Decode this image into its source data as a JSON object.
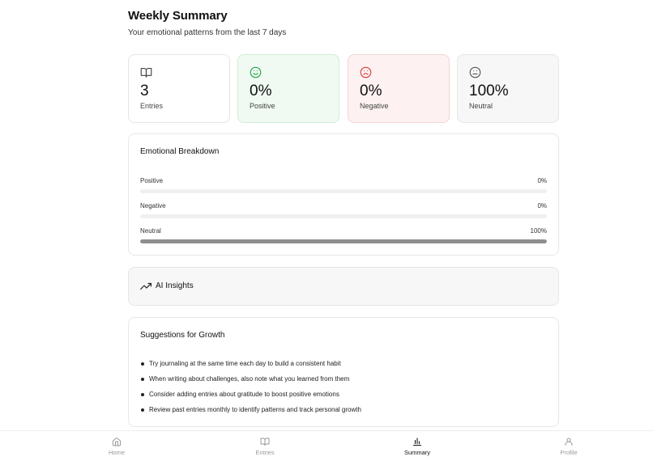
{
  "header": {
    "title": "Weekly Summary",
    "subtitle": "Your emotional patterns from the last 7 days"
  },
  "stats": [
    {
      "value": "3",
      "label": "Entries",
      "icon": "book-open-icon",
      "tone": "default"
    },
    {
      "value": "0%",
      "label": "Positive",
      "icon": "smile-icon",
      "tone": "positive",
      "color": "#22a447"
    },
    {
      "value": "0%",
      "label": "Negative",
      "icon": "frown-icon",
      "tone": "negative",
      "color": "#d93a3a"
    },
    {
      "value": "100%",
      "label": "Neutral",
      "icon": "neutral-face-icon",
      "tone": "neutral",
      "color": "#555555"
    }
  ],
  "breakdown": {
    "title": "Emotional Breakdown",
    "rows": [
      {
        "label": "Positive",
        "percent_text": "0%",
        "percent": 0
      },
      {
        "label": "Negative",
        "percent_text": "0%",
        "percent": 0
      },
      {
        "label": "Neutral",
        "percent_text": "100%",
        "percent": 100
      }
    ]
  },
  "insights": {
    "title": "AI Insights",
    "icon": "trending-up-icon"
  },
  "suggestions": {
    "title": "Suggestions for Growth",
    "items": [
      "Try journaling at the same time each day to build a consistent habit",
      "When writing about challenges, also note what you learned from them",
      "Consider adding entries about gratitude to boost positive emotions",
      "Review past entries monthly to identify patterns and track personal growth"
    ]
  },
  "nav": {
    "active": "Summary",
    "items": [
      {
        "label": "Home",
        "icon": "home-icon"
      },
      {
        "label": "Entries",
        "icon": "book-open-icon"
      },
      {
        "label": "Summary",
        "icon": "bar-chart-icon"
      },
      {
        "label": "Profile",
        "icon": "user-icon"
      }
    ]
  }
}
